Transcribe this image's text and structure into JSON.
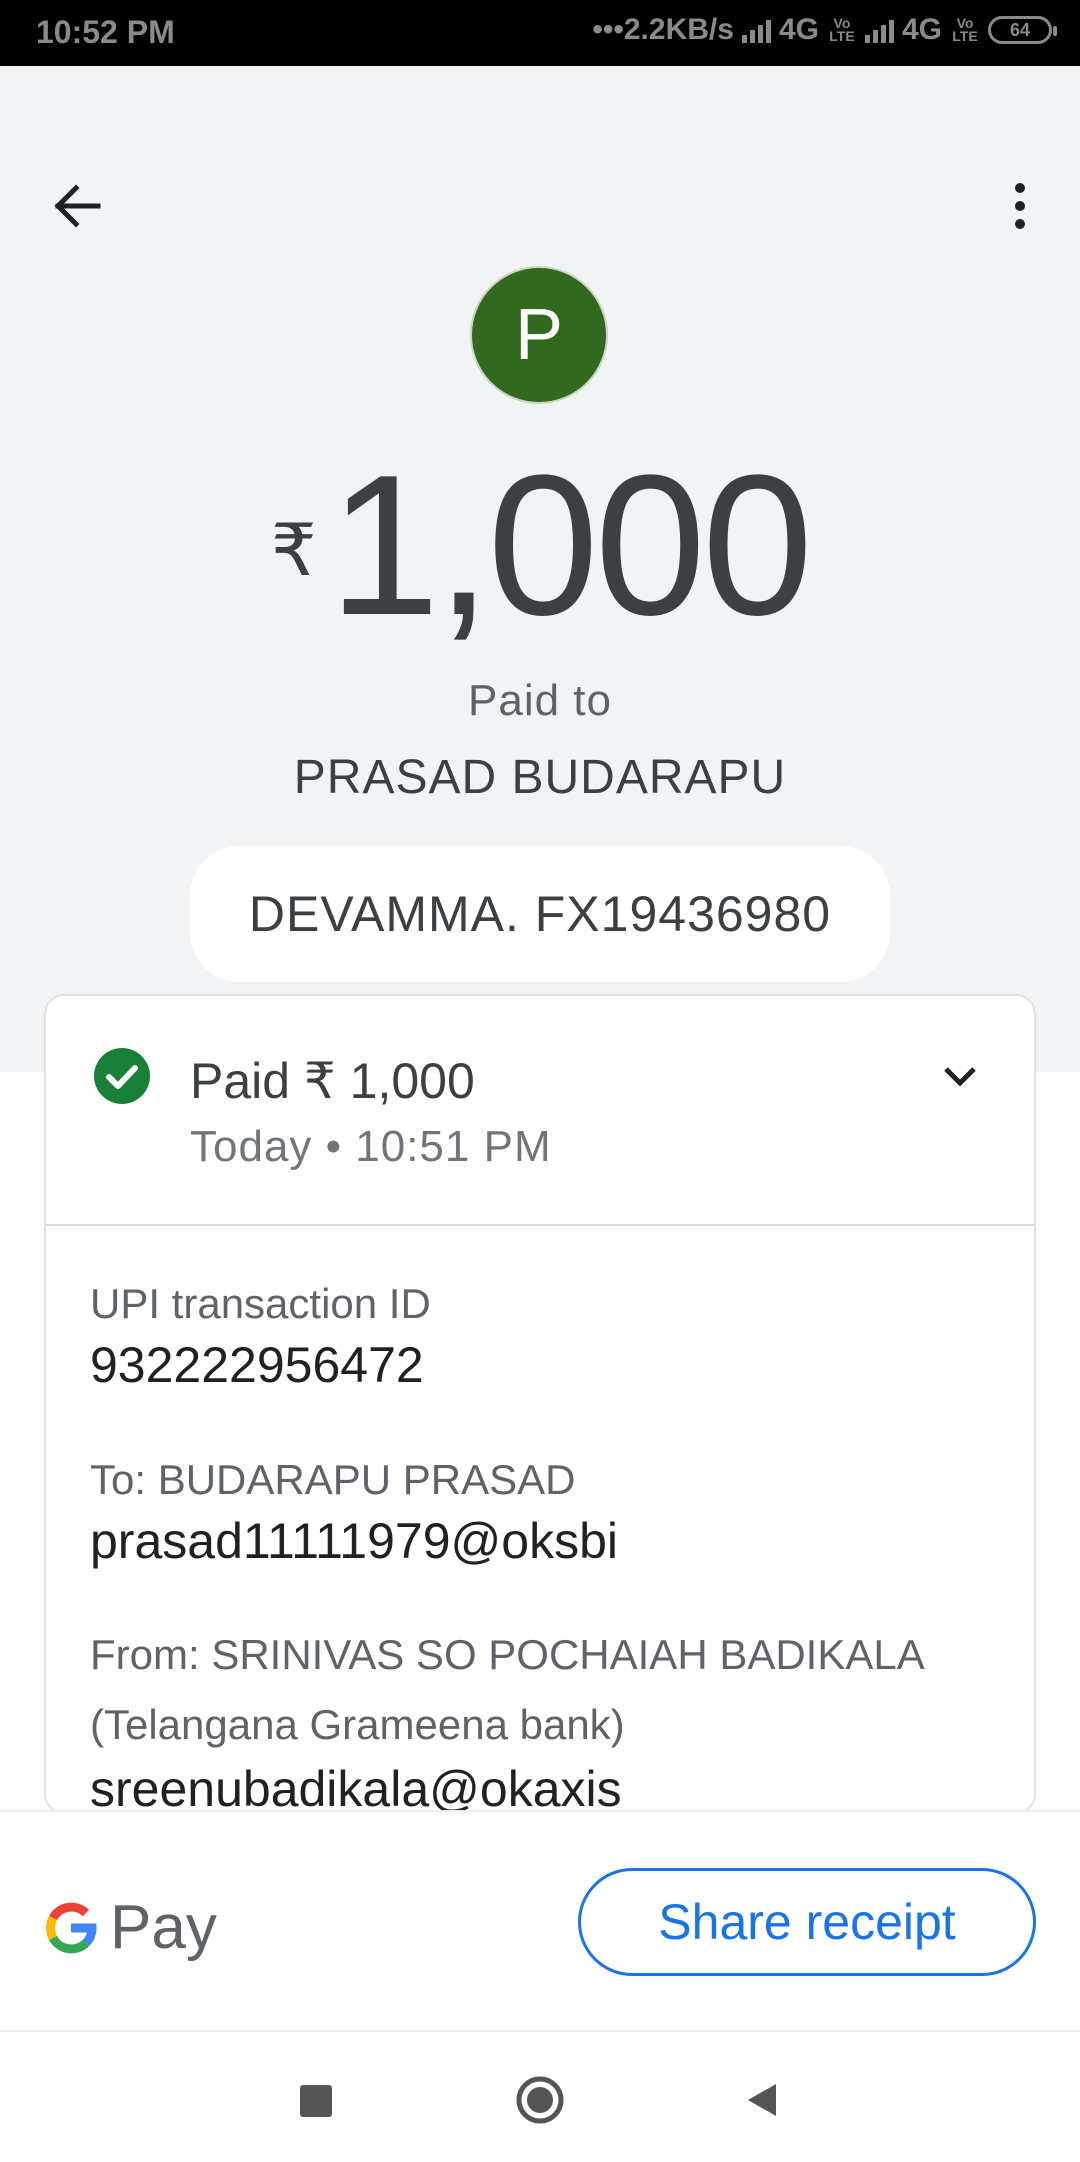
{
  "status_bar": {
    "time": "10:52 PM",
    "network_speed": "2.2KB/s",
    "net1": "4G",
    "net2": "4G",
    "volte": "Vo LTE",
    "battery": "64"
  },
  "header": {
    "back_icon": "arrow-left-icon",
    "menu_icon": "more-vert-icon"
  },
  "payee": {
    "avatar_letter": "P",
    "avatar_color": "#33691e",
    "currency": "₹",
    "amount": "1,000",
    "paid_to_label": "Paid to",
    "name": "PRASAD BUDARAPU",
    "note": "DEVAMMA. FX19436980"
  },
  "transaction": {
    "status": "Paid ₹ 1,000",
    "time": "Today • 10:51 PM",
    "status_color": "#188038",
    "upi_label": "UPI transaction ID",
    "upi_id": "932222956472",
    "to_label": "To: BUDARAPU  PRASAD",
    "to_vpa": "prasad11111979@oksbi",
    "from_label": "From: SRINIVAS SO POCHAIAH BADIKALA",
    "from_bank": "(Telangana Grameena bank)",
    "from_vpa": "sreenubadikala@okaxis"
  },
  "footer": {
    "brand": "Pay",
    "share_label": "Share receipt",
    "accent": "#1a73e8"
  }
}
